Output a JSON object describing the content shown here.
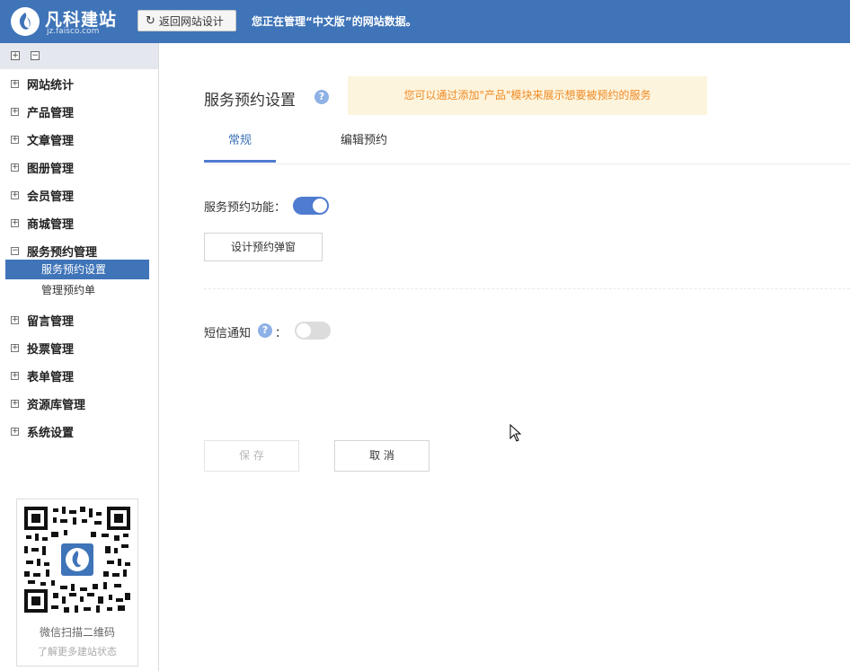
{
  "header": {
    "logo_name": "凡科建站",
    "logo_sub": "jz.faisco.com",
    "back_button": "返回网站设计",
    "manage_text": "您正在管理“中文版”的网站数据。"
  },
  "sidebar": {
    "items": [
      {
        "label": "网站统计",
        "expander": "+"
      },
      {
        "label": "产品管理",
        "expander": "+"
      },
      {
        "label": "文章管理",
        "expander": "+"
      },
      {
        "label": "图册管理",
        "expander": "+"
      },
      {
        "label": "会员管理",
        "expander": "+"
      },
      {
        "label": "商城管理",
        "expander": "+"
      },
      {
        "label": "服务预约管理",
        "expander": "−"
      },
      {
        "label": "留言管理",
        "expander": "+"
      },
      {
        "label": "投票管理",
        "expander": "+"
      },
      {
        "label": "表单管理",
        "expander": "+"
      },
      {
        "label": "资源库管理",
        "expander": "+"
      },
      {
        "label": "系统设置",
        "expander": "+"
      }
    ],
    "sub_items": [
      {
        "label": "服务预约设置",
        "active": true
      },
      {
        "label": "管理预约单",
        "active": false
      }
    ],
    "qr_text1": "微信扫描二维码",
    "qr_text2": "了解更多建站状态"
  },
  "main": {
    "title": "服务预约设置",
    "help_glyph": "?",
    "notice": "您可以通过添加\"产品\"模块来展示想要被预约的服务",
    "tabs": [
      {
        "label": "常规",
        "active": true
      },
      {
        "label": "编辑预约",
        "active": false
      }
    ],
    "booking_label": "服务预约功能：",
    "booking_enabled": true,
    "design_popup_button": "设计预约弹窗",
    "sms_label": "短信通知",
    "sms_colon": "：",
    "sms_enabled": false,
    "save_button": "保 存",
    "cancel_button": "取 消"
  },
  "colors": {
    "header_bg": "#3f74b8",
    "accent": "#4f7bd0",
    "notice_bg": "#fdf4dd",
    "notice_text": "#f08a24"
  },
  "icons": {
    "logo": "faisco-logo-icon",
    "refresh": "refresh-icon",
    "help": "help-icon",
    "qr": "qr-code",
    "cursor": "mouse-cursor"
  }
}
